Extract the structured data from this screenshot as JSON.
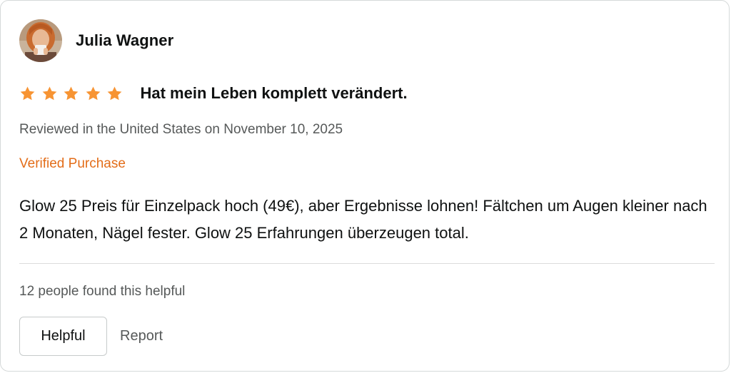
{
  "reviewer": {
    "name": "Julia Wagner",
    "avatar_icon": "user-avatar-photo"
  },
  "review": {
    "rating": 5,
    "max_rating": 5,
    "star_color": "#f79433",
    "title": "Hat mein Leben komplett verändert.",
    "meta": "Reviewed in the United States on November 10, 2025",
    "verified_label": "Verified Purchase",
    "verified_color": "#e36d19",
    "body": "Glow 25 Preis für Einzelpack hoch (49€), aber Ergebnisse lohnen! Fältchen um Augen kleiner nach 2 Monaten, Nägel fester. Glow 25 Erfahrungen überzeugen total."
  },
  "feedback": {
    "helpful_count_text": "12 people found this helpful",
    "helpful_button_label": "Helpful",
    "report_label": "Report"
  }
}
